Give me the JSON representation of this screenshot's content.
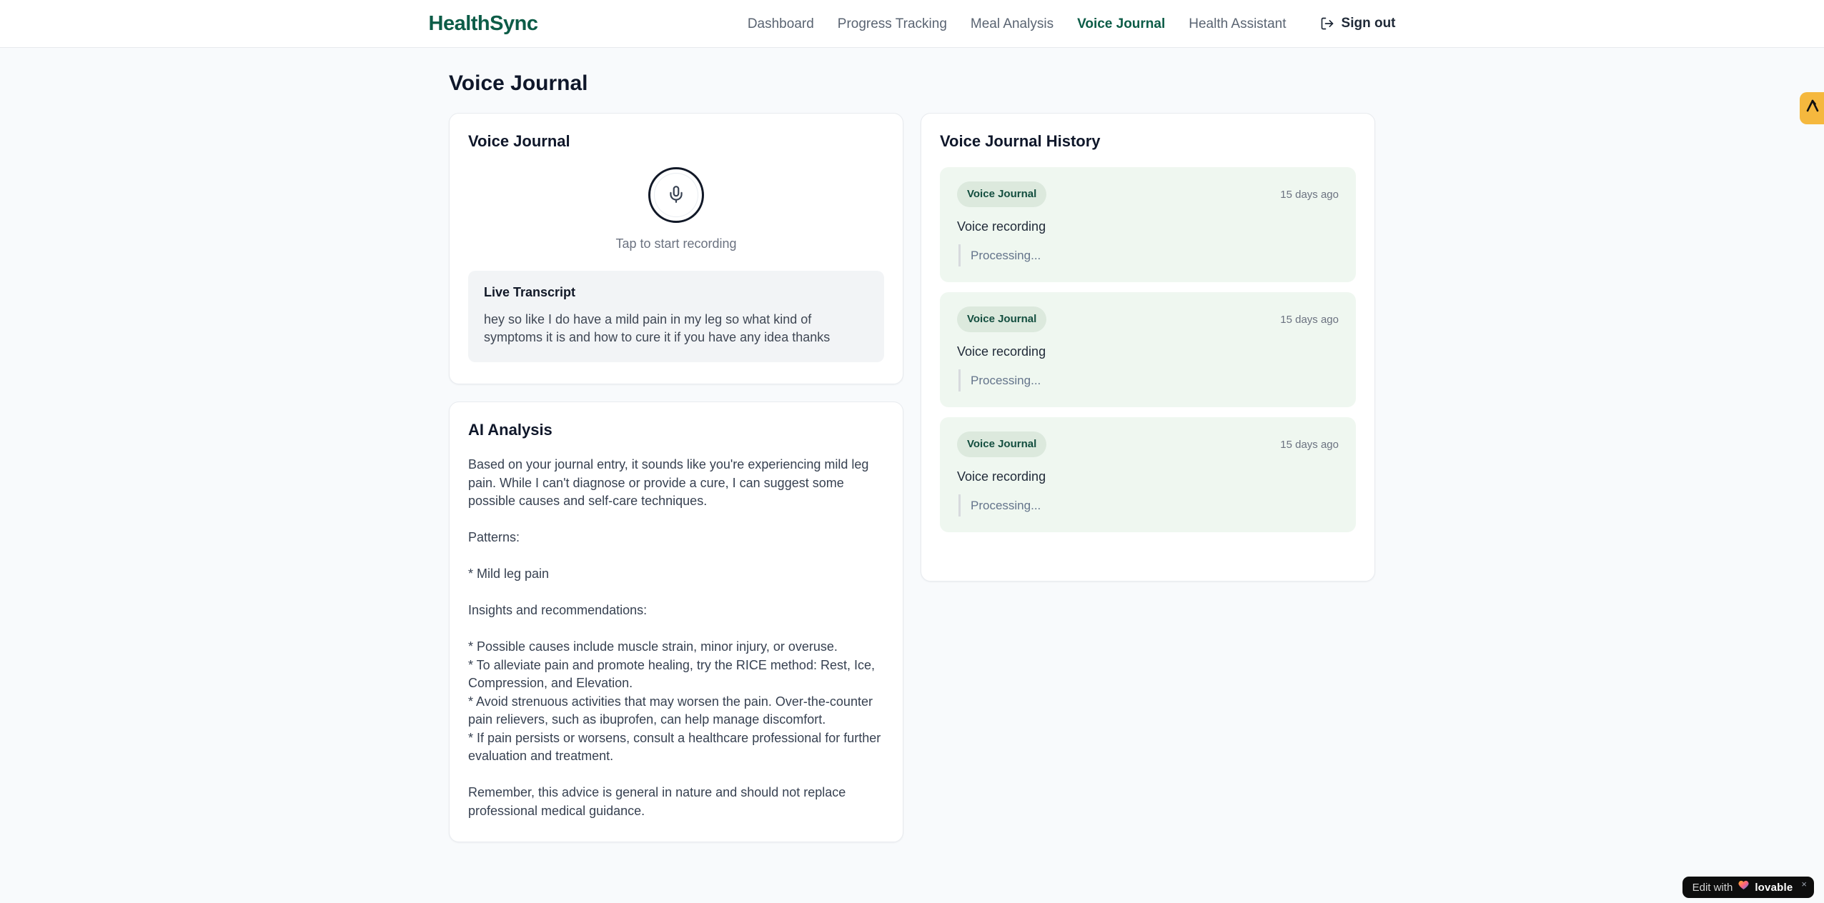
{
  "brand": {
    "name": "HealthSync"
  },
  "colors": {
    "brand_green": "#0c5c47",
    "page_background": "#f8fafc",
    "entry_background": "#eff7f0",
    "badge_background": "#dce9dd",
    "badge_text": "#134e3f",
    "side_badge_amber": "#f5b83e",
    "lovable_background": "#0d0d0d"
  },
  "nav": {
    "items": [
      {
        "label": "Dashboard",
        "active": false
      },
      {
        "label": "Progress Tracking",
        "active": false
      },
      {
        "label": "Meal Analysis",
        "active": false
      },
      {
        "label": "Voice Journal",
        "active": true
      },
      {
        "label": "Health Assistant",
        "active": false
      }
    ],
    "sign_out": "Sign out"
  },
  "page": {
    "title": "Voice Journal"
  },
  "recorder": {
    "title": "Voice Journal",
    "mic_icon": "microphone-icon",
    "tap_hint": "Tap to start recording",
    "transcript_title": "Live Transcript",
    "transcript_text": "hey so like I do have a mild pain in my leg so what kind of symptoms it is and how to cure it if you have any idea thanks"
  },
  "analysis": {
    "title": "AI Analysis",
    "body": "Based on your journal entry, it sounds like you're experiencing mild leg pain. While I can't diagnose or provide a cure, I can suggest some possible causes and self-care techniques.\n\nPatterns:\n\n* Mild leg pain\n\nInsights and recommendations:\n\n* Possible causes include muscle strain, minor injury, or overuse.\n* To alleviate pain and promote healing, try the RICE method: Rest, Ice, Compression, and Elevation.\n* Avoid strenuous activities that may worsen the pain. Over-the-counter pain relievers, such as ibuprofen, can help manage discomfort.\n* If pain persists or worsens, consult a healthcare professional for further evaluation and treatment.\n\nRemember, this advice is general in nature and should not replace professional medical guidance."
  },
  "history": {
    "title": "Voice Journal History",
    "entries": [
      {
        "badge": "Voice Journal",
        "time": "15 days ago",
        "title": "Voice recording",
        "status": "Processing..."
      },
      {
        "badge": "Voice Journal",
        "time": "15 days ago",
        "title": "Voice recording",
        "status": "Processing..."
      },
      {
        "badge": "Voice Journal",
        "time": "15 days ago",
        "title": "Voice recording",
        "status": "Processing..."
      }
    ]
  },
  "lovable": {
    "prefix": "Edit with",
    "brand": "lovable",
    "close": "×"
  }
}
